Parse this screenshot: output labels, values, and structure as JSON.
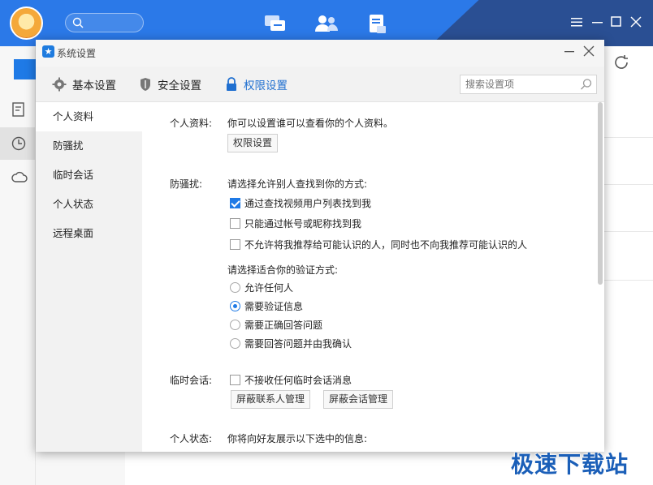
{
  "app": {
    "search_icon": "search-icon",
    "top_icons": [
      "chat-icon",
      "contacts-icon",
      "files-icon"
    ],
    "window_controls": [
      "menu-icon",
      "minimize-icon",
      "maximize-icon",
      "close-icon"
    ],
    "sidebar_icons": [
      "notes-icon",
      "clock-icon",
      "cloud-icon"
    ],
    "colors": {
      "header": "#2b79e8",
      "header_dark": "#2a4f93",
      "accent": "#1f7ae6"
    }
  },
  "dialog": {
    "title": "系统设置",
    "tabs": [
      {
        "label": "基本设置",
        "icon": "gear-icon",
        "active": false
      },
      {
        "label": "安全设置",
        "icon": "shield-icon",
        "active": false
      },
      {
        "label": "权限设置",
        "icon": "lock-icon",
        "active": true
      }
    ],
    "search_placeholder": "搜索设置项",
    "sidebar": [
      {
        "label": "个人资料",
        "active": true
      },
      {
        "label": "防骚扰",
        "active": false
      },
      {
        "label": "临时会话",
        "active": false
      },
      {
        "label": "个人状态",
        "active": false
      },
      {
        "label": "远程桌面",
        "active": false
      }
    ],
    "sections": {
      "profile": {
        "label": "个人资料:",
        "desc": "你可以设置谁可以查看你的个人资料。",
        "button": "权限设置"
      },
      "harass": {
        "label": "防骚扰:",
        "find_prompt": "请选择允许别人查找到你的方式:",
        "find_options": [
          {
            "label": "通过查找视频用户列表找到我",
            "checked": true
          },
          {
            "label": "只能通过帐号或昵称找到我",
            "checked": false
          },
          {
            "label": "不允许将我推荐给可能认识的人，同时也不向我推荐可能认识的人",
            "checked": false
          }
        ],
        "verify_prompt": "请选择适合你的验证方式:",
        "verify_options": [
          {
            "label": "允许任何人",
            "selected": false
          },
          {
            "label": "需要验证信息",
            "selected": true
          },
          {
            "label": "需要正确回答问题",
            "selected": false
          },
          {
            "label": "需要回答问题并由我确认",
            "selected": false
          }
        ]
      },
      "temp_chat": {
        "label": "临时会话:",
        "option": {
          "label": "不接收任何临时会话消息",
          "checked": false
        },
        "buttons": [
          "屏蔽联系人管理",
          "屏蔽会话管理"
        ]
      },
      "status": {
        "label": "个人状态:",
        "desc": "你将向好友展示以下选中的信息:"
      }
    }
  },
  "watermark": "极速下载站"
}
